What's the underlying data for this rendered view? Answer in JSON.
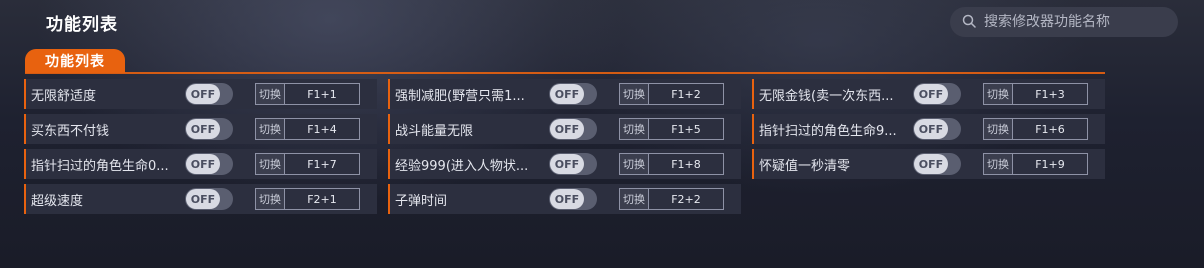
{
  "header": {
    "title": "功能列表"
  },
  "search": {
    "placeholder": "搜索修改器功能名称"
  },
  "section": {
    "tab_label": "功能列表"
  },
  "switch_label": "切换",
  "features": [
    {
      "label": "无限舒适度",
      "state": "OFF",
      "hotkey": "F1+1"
    },
    {
      "label": "强制减肥(野营只需1...",
      "state": "OFF",
      "hotkey": "F1+2"
    },
    {
      "label": "无限金钱(卖一次东西...",
      "state": "OFF",
      "hotkey": "F1+3"
    },
    {
      "label": "买东西不付钱",
      "state": "OFF",
      "hotkey": "F1+4"
    },
    {
      "label": "战斗能量无限",
      "state": "OFF",
      "hotkey": "F1+5"
    },
    {
      "label": "指针扫过的角色生命9...",
      "state": "OFF",
      "hotkey": "F1+6"
    },
    {
      "label": "指针扫过的角色生命0...",
      "state": "OFF",
      "hotkey": "F1+7"
    },
    {
      "label": "经验999(进入人物状...",
      "state": "OFF",
      "hotkey": "F1+8"
    },
    {
      "label": "怀疑值一秒清零",
      "state": "OFF",
      "hotkey": "F1+9"
    },
    {
      "label": "超级速度",
      "state": "OFF",
      "hotkey": "F2+1"
    },
    {
      "label": "子弹时间",
      "state": "OFF",
      "hotkey": "F2+2"
    }
  ]
}
